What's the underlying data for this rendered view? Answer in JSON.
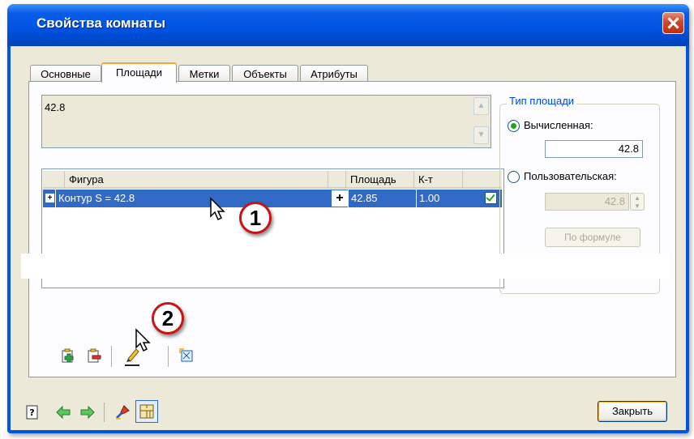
{
  "window": {
    "title": "Свойства комнаты"
  },
  "tabs": [
    {
      "label": "Основные"
    },
    {
      "label": "Площади"
    },
    {
      "label": "Метки"
    },
    {
      "label": "Объекты"
    },
    {
      "label": "Атрибуты"
    }
  ],
  "active_tab": "Площади",
  "area_text": {
    "value": "42.8"
  },
  "table": {
    "columns": [
      "Фигура",
      "Площадь",
      "К-т"
    ],
    "rows": [
      {
        "expander": "+",
        "figure": "Контур S = 42.8",
        "op": "+",
        "area": "42.85",
        "coef": "1.00",
        "checked": true
      }
    ]
  },
  "area_type": {
    "title": "Тип площади",
    "calculated_label": "Вычисленная:",
    "calculated_value": "42.8",
    "custom_label": "Пользовательская:",
    "custom_value": "42.8",
    "formula_button": "По формуле",
    "selected": "calculated"
  },
  "callouts": [
    "1",
    "2"
  ],
  "footer": {
    "close_label": "Закрыть"
  },
  "colors": {
    "title_bar": "#0054e3",
    "selection": "#316ac5",
    "callout_border": "#c81414"
  }
}
